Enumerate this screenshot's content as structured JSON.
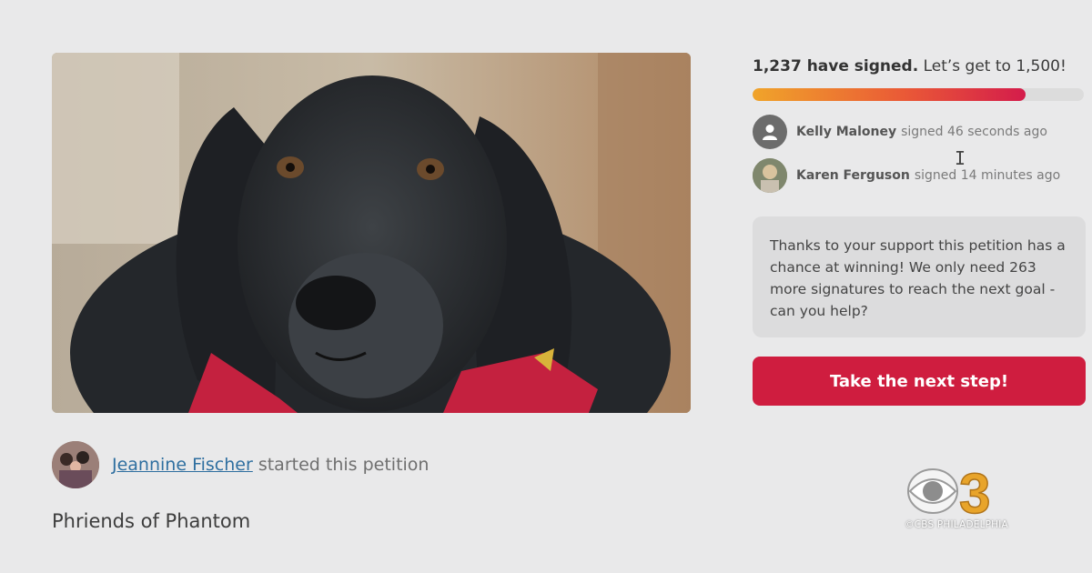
{
  "petition": {
    "starter_name": "Jeannine Fischer",
    "starter_suffix": " started this petition",
    "title": "Phriends of Phantom"
  },
  "progress": {
    "signed_bold": "1,237 have signed.",
    "goal_text": " Let’s get to 1,500!",
    "fraction": 0.8247
  },
  "recent_signers": [
    {
      "name": "Kelly Maloney",
      "time": "signed 46 seconds ago",
      "avatar_icon": "person-silhouette-icon"
    },
    {
      "name": "Karen Ferguson",
      "time": "signed 14 minutes ago",
      "avatar_icon": "user-photo"
    }
  ],
  "support_message": "Thanks to your support this petition has a chance at winning! We only need 263 more signatures to reach the next goal - can you help?",
  "cta_label": "Take the next step!",
  "watermark": {
    "logo_number": "3",
    "caption": "©CBS PHILADELPHIA"
  },
  "colors": {
    "background": "#e9e9ea",
    "link": "#2f6fa0",
    "cta": "#cf1d3f",
    "progress_start": "#f0a42a",
    "progress_end": "#d41c4b"
  }
}
